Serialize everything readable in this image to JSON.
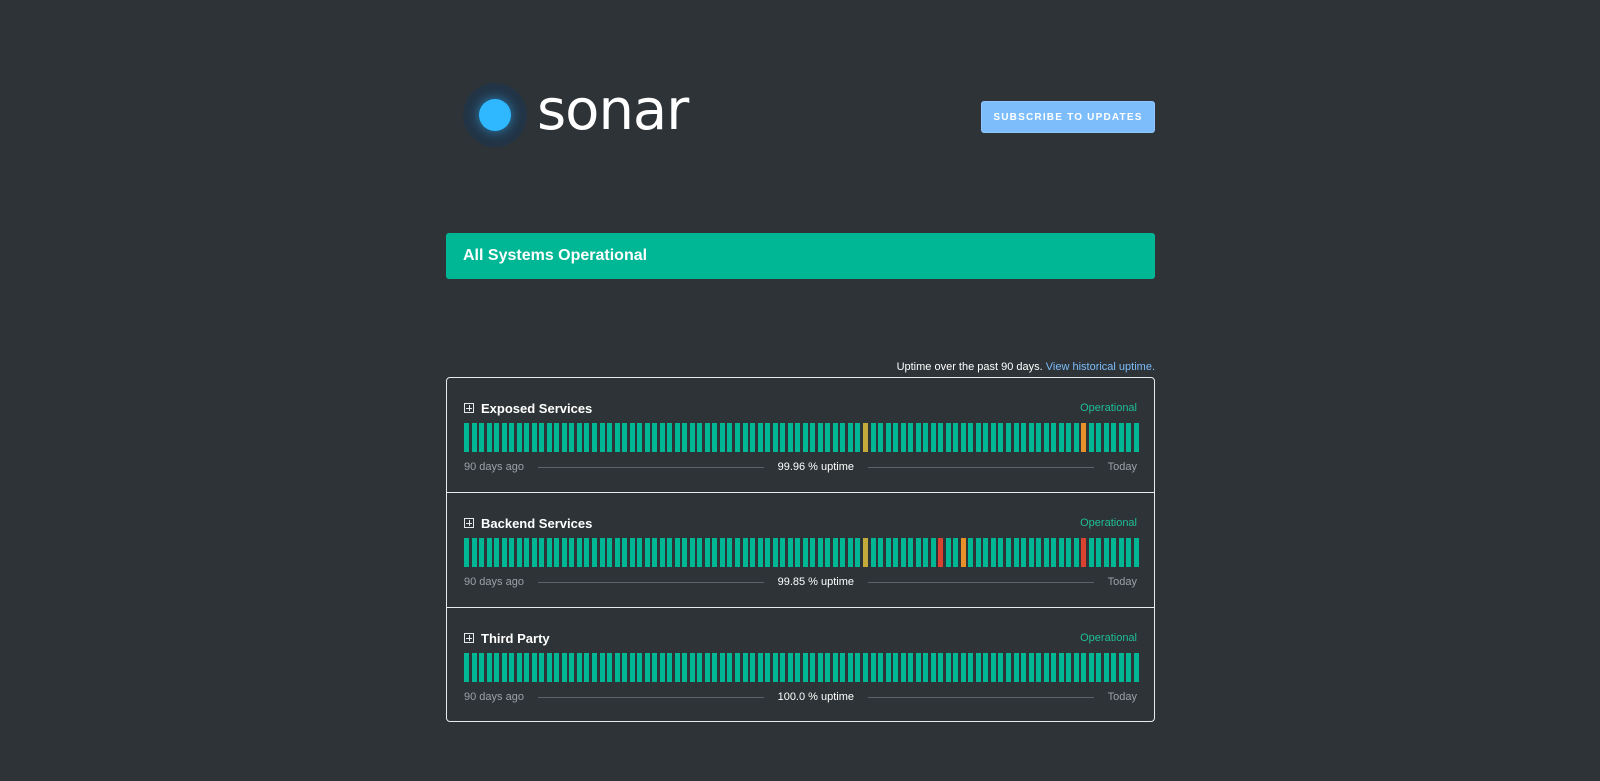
{
  "brand": {
    "name": "sonar",
    "icon": "sonar-logo-icon"
  },
  "header": {
    "subscribe_label": "SUBSCRIBE TO UPDATES"
  },
  "banner": {
    "text": "All Systems Operational",
    "color": "#00b795"
  },
  "uptime": {
    "caption": "Uptime over the past 90 days.",
    "link": "View historical uptime."
  },
  "colors": {
    "operational": "#00b795",
    "minor": "#c4a93b",
    "partial": "#e8912b",
    "major": "#d9432f"
  },
  "components": [
    {
      "name": "Exposed Services",
      "status": "Operational",
      "uptime_text": "99.96 % uptime",
      "start_label": "90 days ago",
      "end_label": "Today",
      "incidents": [
        {
          "day": 53,
          "level": "minor"
        },
        {
          "day": 82,
          "level": "partial"
        }
      ]
    },
    {
      "name": "Backend Services",
      "status": "Operational",
      "uptime_text": "99.85 % uptime",
      "start_label": "90 days ago",
      "end_label": "Today",
      "incidents": [
        {
          "day": 53,
          "level": "minor"
        },
        {
          "day": 63,
          "level": "major"
        },
        {
          "day": 66,
          "level": "partial"
        },
        {
          "day": 82,
          "level": "major"
        }
      ]
    },
    {
      "name": "Third Party",
      "status": "Operational",
      "uptime_text": "100.0 % uptime",
      "start_label": "90 days ago",
      "end_label": "Today",
      "incidents": []
    }
  ]
}
